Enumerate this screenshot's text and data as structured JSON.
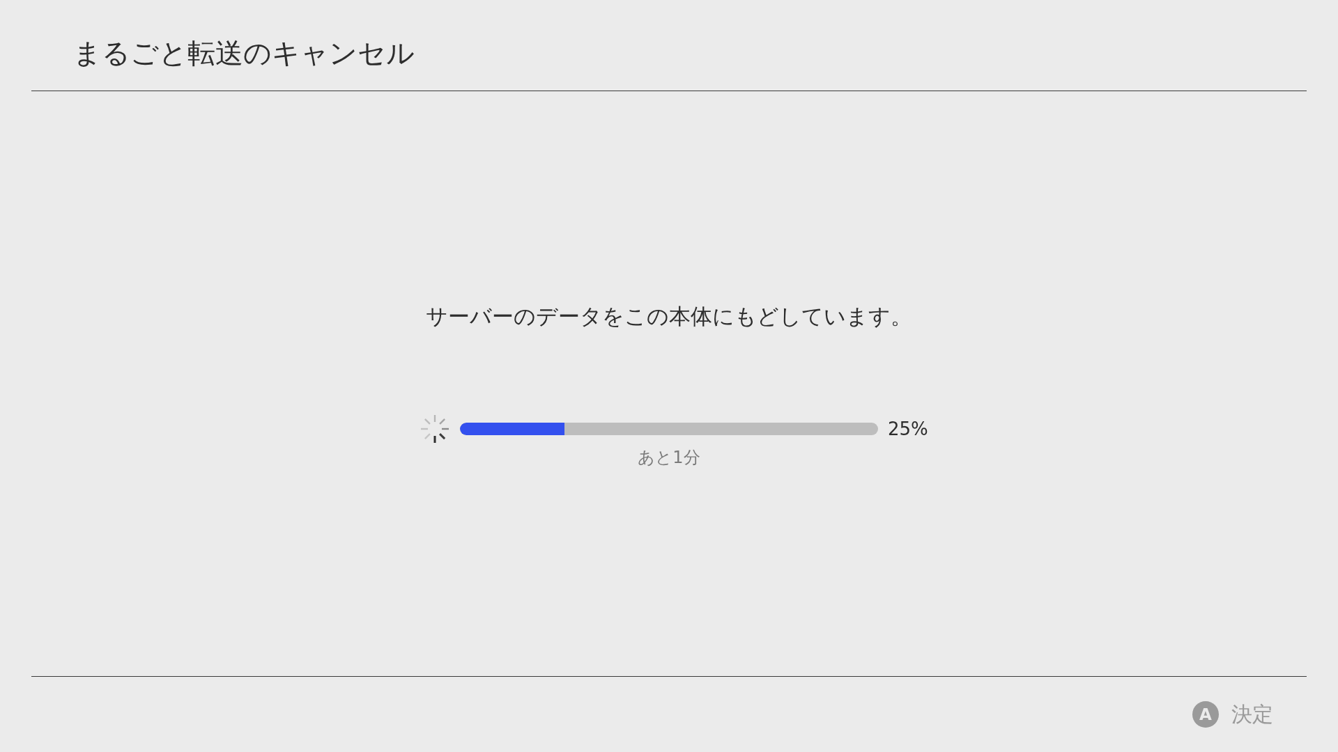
{
  "header": {
    "title": "まるごと転送のキャンセル"
  },
  "message": "サーバーのデータをこの本体にもどしています。",
  "progress": {
    "level": 0.25,
    "reading": "25%",
    "remaining": "あと1分"
  },
  "footer": {
    "actions": [
      {
        "key": "A",
        "label": "決定",
        "disabled": true
      }
    ]
  }
}
